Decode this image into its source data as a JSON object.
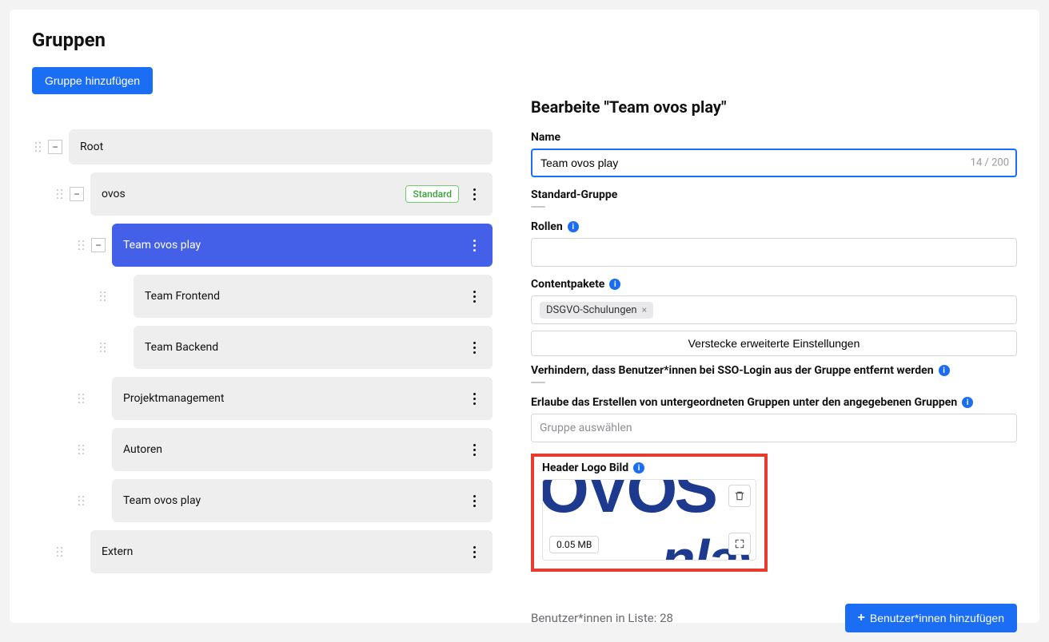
{
  "page": {
    "title": "Gruppen",
    "add_group_button": "Gruppe hinzufügen"
  },
  "tree": {
    "root": {
      "label": "Root"
    },
    "ovos": {
      "label": "ovos",
      "badge": "Standard"
    },
    "team_ovos_play": {
      "label": "Team ovos play"
    },
    "team_frontend": {
      "label": "Team Frontend"
    },
    "team_backend": {
      "label": "Team Backend"
    },
    "projektmanagement": {
      "label": "Projektmanagement"
    },
    "autoren": {
      "label": "Autoren"
    },
    "team_ovos_play_2": {
      "label": "Team ovos play"
    },
    "extern": {
      "label": "Extern"
    }
  },
  "form": {
    "title": "Bearbeite \"Team ovos play\"",
    "name_label": "Name",
    "name_value": "Team ovos play",
    "name_char_count": "14 / 200",
    "standard_group_label": "Standard-Gruppe",
    "roles_label": "Rollen",
    "contentpakete_label": "Contentpakete",
    "contentpakete_tag": "DSGVO-Schulungen",
    "hide_extended_button": "Verstecke erweiterte Einstellungen",
    "sso_prevent_label": "Verhindern, dass Benutzer*innen bei SSO-Login aus der Gruppe entfernt werden",
    "allow_subgroups_label": "Erlaube das Erstellen von untergeordneten Gruppen unter den angegebenen Gruppen",
    "group_select_placeholder": "Gruppe auswählen",
    "header_logo_label": "Header Logo Bild",
    "image_size": "0.05 MB",
    "user_count_text": "Benutzer*innen in Liste: 28",
    "add_users_button": "Benutzer*innen hinzufügen"
  }
}
